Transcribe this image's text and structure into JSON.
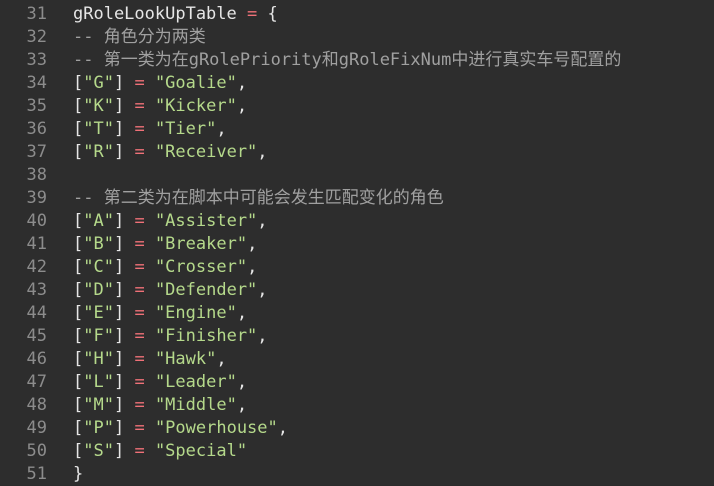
{
  "editor": {
    "lines": [
      {
        "no": "31",
        "kind": "header",
        "ident": "gRoleLookUpTable",
        "op": " = ",
        "brace": "{"
      },
      {
        "no": "32",
        "kind": "comment",
        "text": "-- 角色分为两类"
      },
      {
        "no": "33",
        "kind": "comment",
        "text": "-- 第一类为在gRolePriority和gRoleFixNum中进行真实车号配置的"
      },
      {
        "no": "34",
        "kind": "entry",
        "key": "\"G\"",
        "value": "\"Goalie\"",
        "tail": ","
      },
      {
        "no": "35",
        "kind": "entry",
        "key": "\"K\"",
        "value": "\"Kicker\"",
        "tail": ","
      },
      {
        "no": "36",
        "kind": "entry",
        "key": "\"T\"",
        "value": "\"Tier\"",
        "tail": ","
      },
      {
        "no": "37",
        "kind": "entry",
        "key": "\"R\"",
        "value": "\"Receiver\"",
        "tail": ","
      },
      {
        "no": "38",
        "kind": "blank"
      },
      {
        "no": "39",
        "kind": "comment",
        "text": "-- 第二类为在脚本中可能会发生匹配变化的角色"
      },
      {
        "no": "40",
        "kind": "entry",
        "key": "\"A\"",
        "value": "\"Assister\"",
        "tail": ","
      },
      {
        "no": "41",
        "kind": "entry",
        "key": "\"B\"",
        "value": "\"Breaker\"",
        "tail": ","
      },
      {
        "no": "42",
        "kind": "entry",
        "key": "\"C\"",
        "value": "\"Crosser\"",
        "tail": ","
      },
      {
        "no": "43",
        "kind": "entry",
        "key": "\"D\"",
        "value": "\"Defender\"",
        "tail": ","
      },
      {
        "no": "44",
        "kind": "entry",
        "key": "\"E\"",
        "value": "\"Engine\"",
        "tail": ","
      },
      {
        "no": "45",
        "kind": "entry",
        "key": "\"F\"",
        "value": "\"Finisher\"",
        "tail": ","
      },
      {
        "no": "46",
        "kind": "entry",
        "key": "\"H\"",
        "value": "\"Hawk\"",
        "tail": ","
      },
      {
        "no": "47",
        "kind": "entry",
        "key": "\"L\"",
        "value": "\"Leader\"",
        "tail": ","
      },
      {
        "no": "48",
        "kind": "entry",
        "key": "\"M\"",
        "value": "\"Middle\"",
        "tail": ","
      },
      {
        "no": "49",
        "kind": "entry",
        "key": "\"P\"",
        "value": "\"Powerhouse\"",
        "tail": ","
      },
      {
        "no": "50",
        "kind": "entry",
        "key": "\"S\"",
        "value": "\"Special\"",
        "tail": ""
      },
      {
        "no": "51",
        "kind": "close",
        "brace": "}"
      }
    ],
    "entry_parts": {
      "open": "[",
      "close": "]",
      "assign": " = "
    },
    "colors": {
      "background": "#2d2d2d",
      "line_number": "#8c8c8c",
      "identifier": "#e6e6e6",
      "operator": "#f07178",
      "string": "#b5d98b",
      "comment": "#a0a0a0"
    }
  }
}
